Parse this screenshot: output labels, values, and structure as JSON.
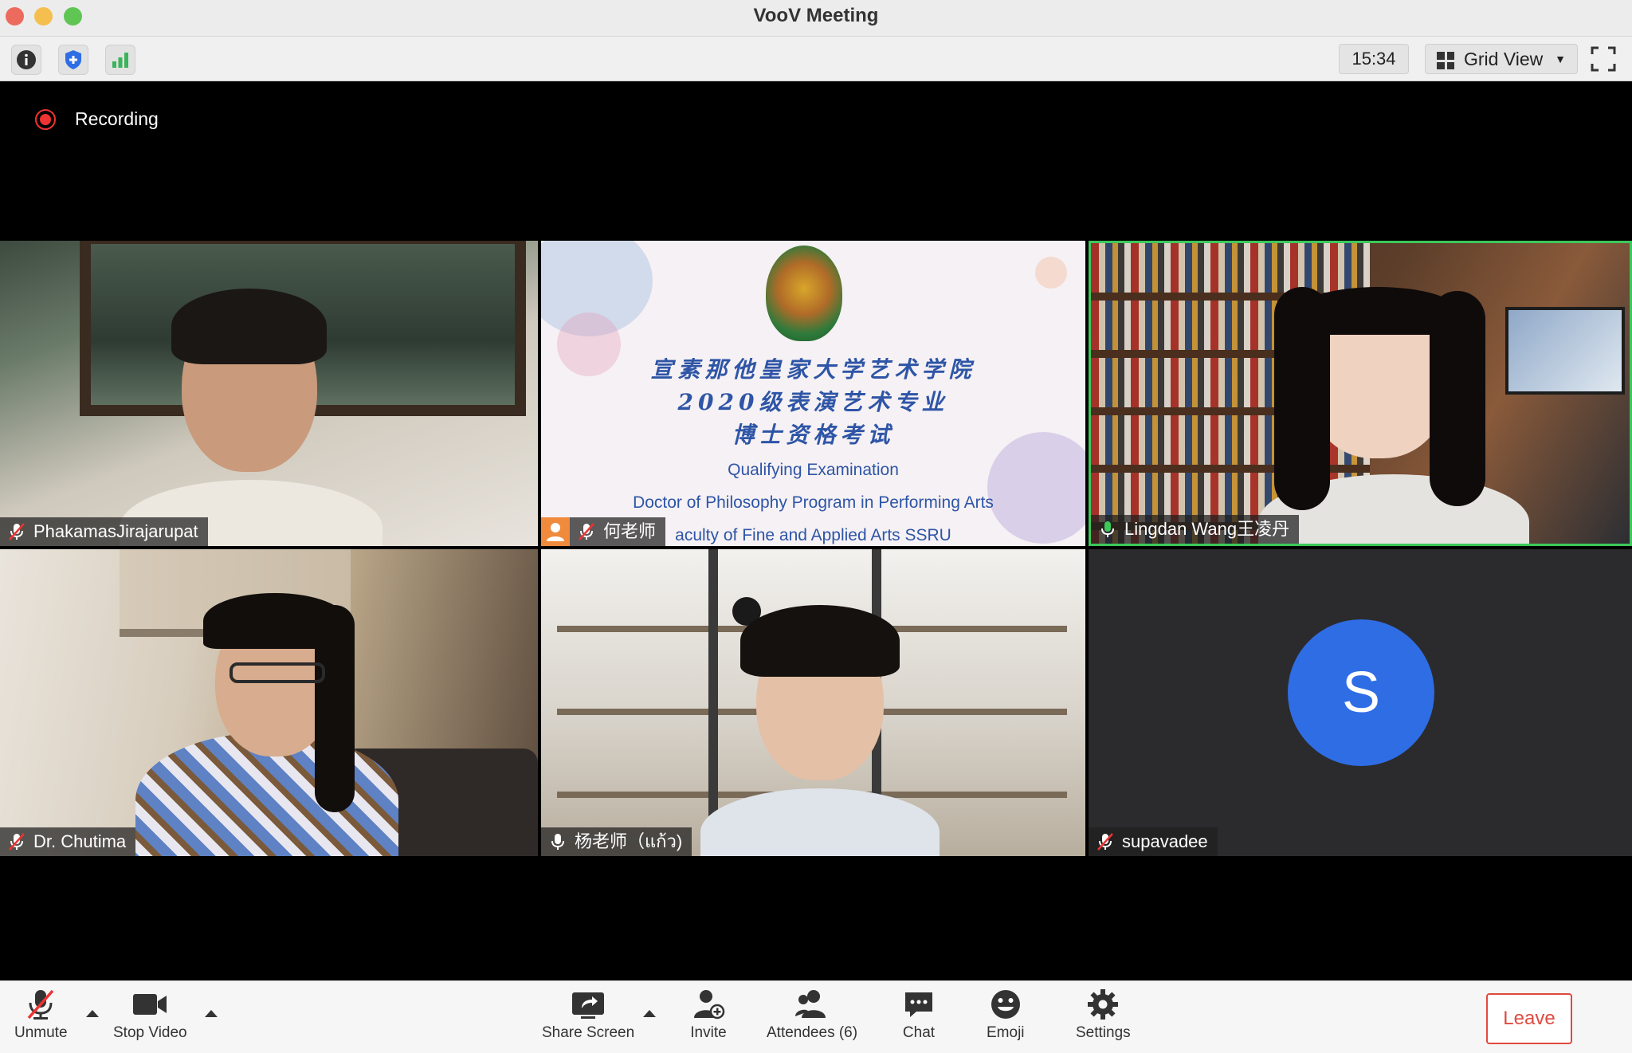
{
  "window": {
    "title": "VooV Meeting"
  },
  "toolbar": {
    "info_icon": "info-icon",
    "security_icon": "shield-icon",
    "signal_icon": "signal-bars-icon",
    "elapsed_time": "15:34",
    "view_mode": "Grid View",
    "fullscreen_icon": "fullscreen-icon"
  },
  "recording": {
    "label": "Recording",
    "color": "#e33333"
  },
  "tiles": [
    {
      "name": "PhakamasJirajarupat",
      "mic": "muted"
    },
    {
      "name": "何老师",
      "mic": "muted",
      "sharing": true
    },
    {
      "name": "Lingdan Wang王凌丹",
      "mic": "speaking",
      "active_speaker": true
    },
    {
      "name": "Dr. Chutima",
      "mic": "muted"
    },
    {
      "name": "杨老师（แก้ว)",
      "mic": "on"
    },
    {
      "name": "supavadee",
      "mic": "muted",
      "avatar_letter": "S",
      "avatar_color": "#2f6de5"
    }
  ],
  "slide": {
    "cn_line1": "宣素那他皇家大学艺术学院",
    "cn_line2": "2020级表演艺术专业",
    "cn_line3": "博士资格考试",
    "en_line1": "Qualifying Examination",
    "en_line2": "Doctor of Philosophy Program in Performing Arts",
    "en_line3": "aculty of Fine and Applied Arts SSRU"
  },
  "bottombar": {
    "unmute": "Unmute",
    "stop_video": "Stop Video",
    "share_screen": "Share Screen",
    "invite": "Invite",
    "attendees": "Attendees (6)",
    "chat": "Chat",
    "emoji": "Emoji",
    "settings": "Settings",
    "leave": "Leave"
  },
  "colors": {
    "active_speaker_border": "#3cc85a",
    "leave": "#e04a3f"
  }
}
